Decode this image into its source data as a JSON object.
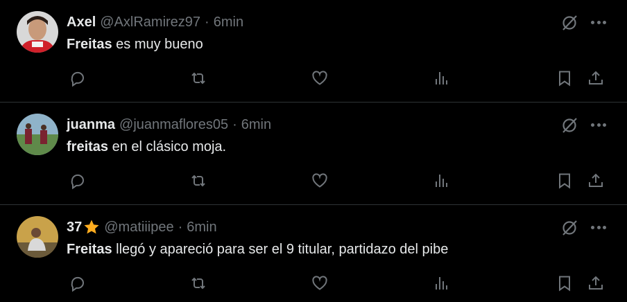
{
  "colors": {
    "background": "#000000",
    "text": "#e7e9ea",
    "muted": "#71767b",
    "divider": "#2f3336",
    "star": "#ffad1f"
  },
  "icons": {
    "actions": [
      "reply-icon",
      "retweet-icon",
      "like-icon",
      "views-icon",
      "bookmark-icon",
      "share-icon"
    ],
    "header": [
      "grok-icon",
      "more-icon"
    ]
  },
  "posts": [
    {
      "name": "Axel",
      "handle": "@AxlRamirez97",
      "separator": "·",
      "time": "6min",
      "text_bold": "Freitas",
      "text_rest": " es muy bueno"
    },
    {
      "name": "juanma",
      "handle": "@juanmaflores05",
      "separator": "·",
      "time": "6min",
      "text_bold": "freitas",
      "text_rest": " en el clásico moja."
    },
    {
      "name": "37",
      "name_emoji": "star",
      "handle": "@matiiipee",
      "separator": "·",
      "time": "6min",
      "text_bold": "Freitas",
      "text_rest": " llegó y apareció para ser el 9 titular, partidazo del pibe"
    }
  ]
}
